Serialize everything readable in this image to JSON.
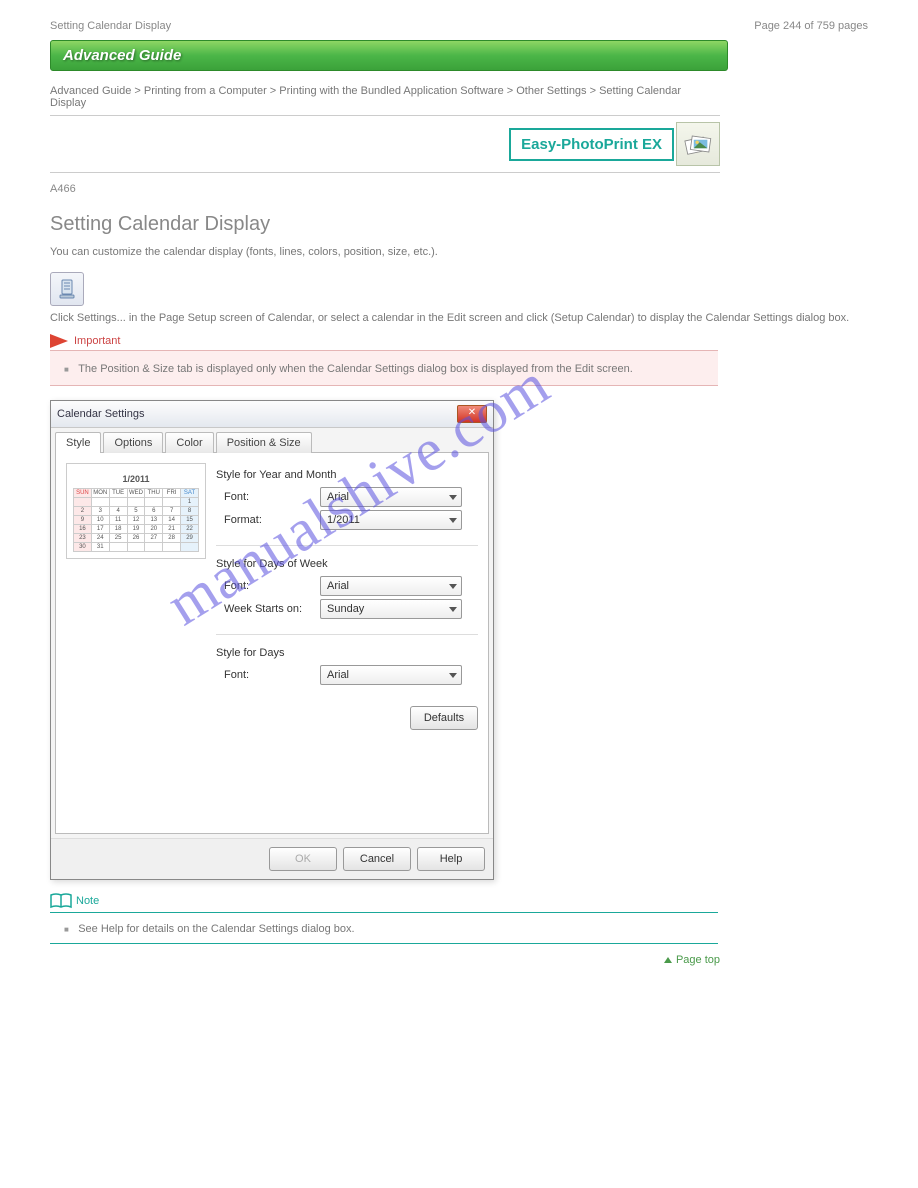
{
  "header": {
    "left": "Setting Calendar Display",
    "right": "Page 244 of 759 pages"
  },
  "banner": "Advanced Guide",
  "breadcrumb": "Advanced Guide > Printing from a Computer > Printing with the Bundled Application Software > Other Settings > Setting Calendar Display",
  "app_badge": "Easy-PhotoPrint EX",
  "code": "A466",
  "title": "Setting Calendar Display",
  "intro": "You can customize the calendar display (fonts, lines, colors, position, size, etc.).",
  "tool_caption": "Click Settings... in the Page Setup screen of Calendar, or select a calendar in the Edit screen and click (Setup Calendar) to display the Calendar Settings dialog box.",
  "important": {
    "label": "Important",
    "text": "The Position & Size tab is displayed only when the Calendar Settings dialog box is displayed from the Edit screen."
  },
  "dialog": {
    "title": "Calendar Settings",
    "tabs": [
      "Style",
      "Options",
      "Color",
      "Position & Size"
    ],
    "active_tab": "Style",
    "preview_month": "1/2011",
    "groups": {
      "year_month": {
        "title": "Style for Year and Month",
        "font_label": "Font:",
        "font_value": "Arial",
        "format_label": "Format:",
        "format_value": "1/2011"
      },
      "days_of_week": {
        "title": "Style for Days of Week",
        "font_label": "Font:",
        "font_value": "Arial",
        "week_label": "Week Starts on:",
        "week_value": "Sunday"
      },
      "days": {
        "title": "Style for Days",
        "font_label": "Font:",
        "font_value": "Arial"
      }
    },
    "buttons": {
      "defaults": "Defaults",
      "ok": "OK",
      "cancel": "Cancel",
      "help": "Help"
    },
    "calendar_header": [
      "SUN",
      "MON",
      "TUE",
      "WED",
      "THU",
      "FRI",
      "SAT"
    ],
    "calendar_cells": [
      [
        "",
        "",
        "",
        "",
        "",
        "",
        "1"
      ],
      [
        "2",
        "3",
        "4",
        "5",
        "6",
        "7",
        "8"
      ],
      [
        "9",
        "10",
        "11",
        "12",
        "13",
        "14",
        "15"
      ],
      [
        "16",
        "17",
        "18",
        "19",
        "20",
        "21",
        "22"
      ],
      [
        "23",
        "24",
        "25",
        "26",
        "27",
        "28",
        "29"
      ],
      [
        "30",
        "31",
        "",
        "",
        "",
        "",
        ""
      ]
    ]
  },
  "note": {
    "label": "Note",
    "text": "See Help for details on the Calendar Settings dialog box."
  },
  "pagetop": "Page top",
  "watermark": "manualshive.com"
}
